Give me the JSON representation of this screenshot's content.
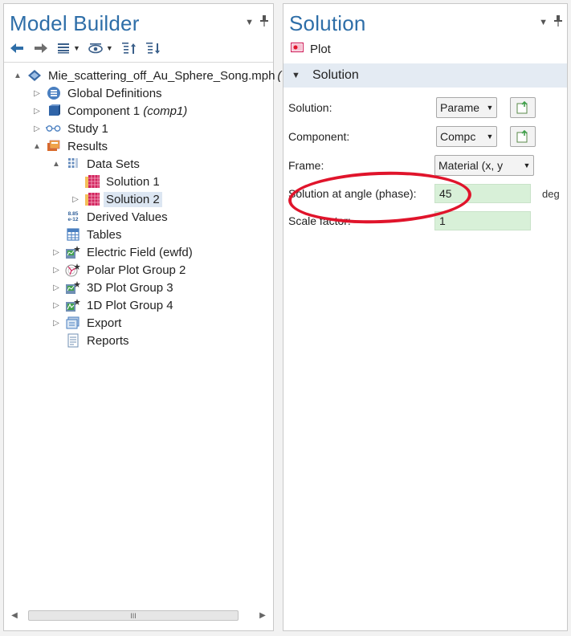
{
  "model_builder": {
    "title": "Model Builder",
    "tree": [
      {
        "label": "Mie_scattering_off_Au_Sphere_Song.mph",
        "suffix": "(",
        "icon": "model-file-icon",
        "twisty": "▲"
      },
      {
        "label": "Global Definitions",
        "icon": "global-definitions-icon",
        "twisty": "▷"
      },
      {
        "label": "Component 1",
        "suffix": "(comp1)",
        "icon": "component-icon",
        "twisty": "▷"
      },
      {
        "label": "Study 1",
        "icon": "study-icon",
        "twisty": "▷"
      },
      {
        "label": "Results",
        "icon": "results-icon",
        "twisty": "▲"
      },
      {
        "label": "Data Sets",
        "icon": "data-sets-icon",
        "twisty": "▲"
      },
      {
        "label": "Solution 1",
        "icon": "solution-dataset-icon",
        "twisty": ""
      },
      {
        "label": "Solution 2",
        "icon": "solution-dataset-icon",
        "twisty": "▷",
        "selected": true
      },
      {
        "label": "Derived Values",
        "icon": "derived-values-icon",
        "twisty": "",
        "icon_text_top": "8.85",
        "icon_text_bottom": "e-12"
      },
      {
        "label": "Tables",
        "icon": "tables-icon",
        "twisty": ""
      },
      {
        "label": "Electric Field (ewfd)",
        "icon": "plot-group-3d-icon",
        "twisty": "▷"
      },
      {
        "label": "Polar Plot Group 2",
        "icon": "polar-plot-icon",
        "twisty": "▷"
      },
      {
        "label": "3D Plot Group 3",
        "icon": "plot-group-3d-icon",
        "twisty": "▷"
      },
      {
        "label": "1D Plot Group 4",
        "icon": "plot-group-1d-icon",
        "twisty": "▷"
      },
      {
        "label": "Export",
        "icon": "export-icon",
        "twisty": "▷"
      },
      {
        "label": "Reports",
        "icon": "reports-icon",
        "twisty": ""
      }
    ],
    "scroll_thumb_grip": "III"
  },
  "settings": {
    "title": "Solution",
    "plot_label": "Plot",
    "section_title": "Solution",
    "fields": {
      "solution_label": "Solution:",
      "solution_value": "Parame",
      "component_label": "Component:",
      "component_value": "Compc",
      "frame_label": "Frame:",
      "frame_value": "Material  (x, y",
      "angle_label": "Solution at angle (phase):",
      "angle_value": "45",
      "angle_unit": "deg",
      "scale_label": "Scale factor:",
      "scale_value": "1"
    }
  },
  "panel_controls": {
    "menu": "▼",
    "pin": "⊥"
  },
  "colors": {
    "title_blue": "#2e6ea8",
    "selection": "#dce6f2",
    "field_green": "#d8f0d8",
    "highlight_ellipse": "#e0142b"
  }
}
